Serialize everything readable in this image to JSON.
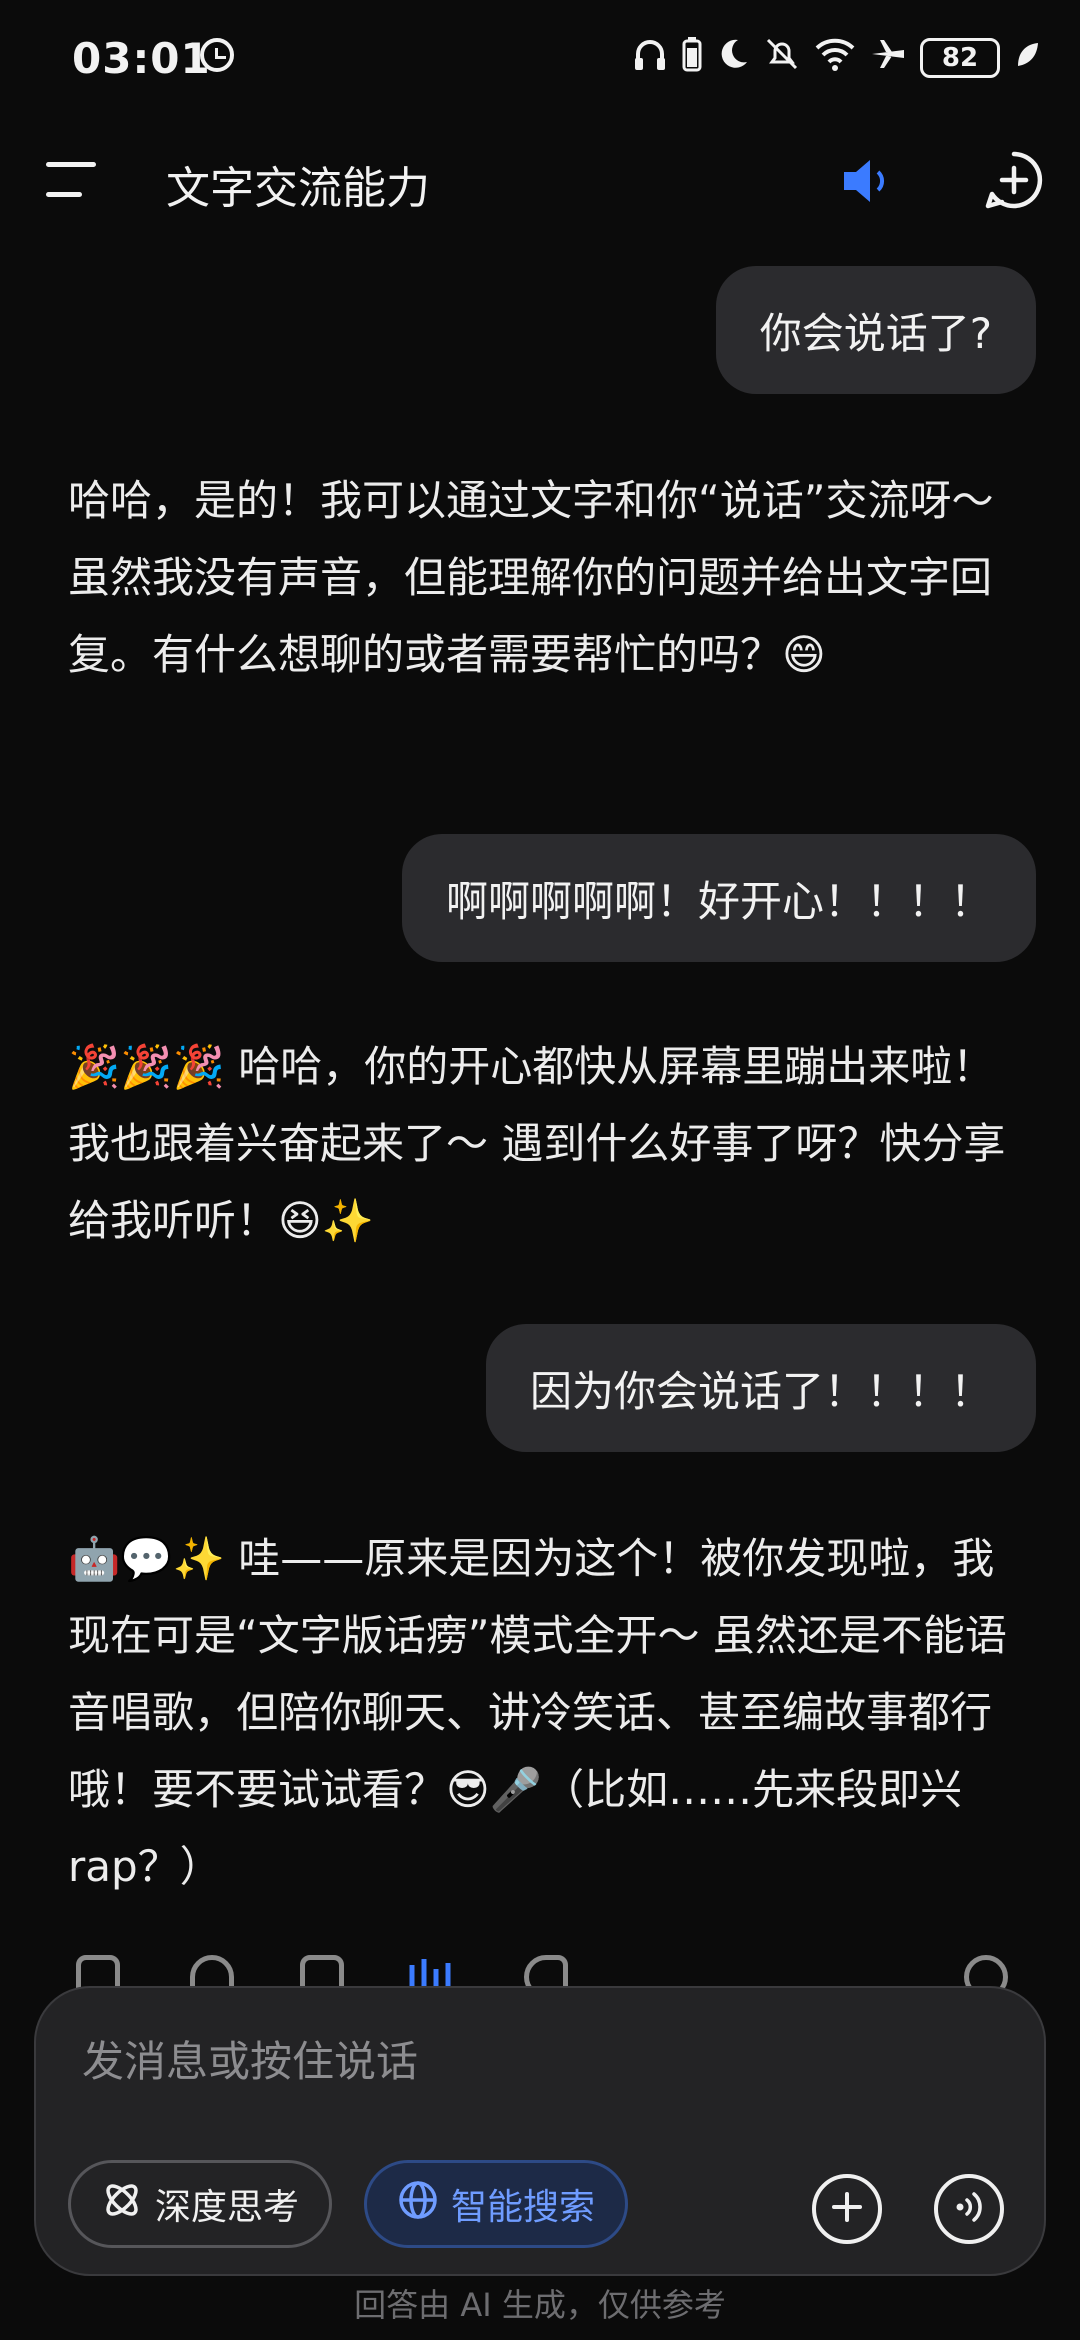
{
  "status_bar": {
    "time": "03:01",
    "battery": "82"
  },
  "header": {
    "title": "文字交流能力"
  },
  "messages": [
    {
      "role": "user",
      "text": "你会说话了?"
    },
    {
      "role": "assistant",
      "text": "哈哈，是的！我可以通过文字和你“说话”交流呀～ 虽然我没有声音，但能理解你的问题并给出文字回复。有什么想聊的或者需要帮忙的吗？😄"
    },
    {
      "role": "user",
      "text": "啊啊啊啊啊！好开心！！！！"
    },
    {
      "role": "assistant",
      "text": "🎉🎉🎉 哈哈，你的开心都快从屏幕里蹦出来啦！我也跟着兴奋起来了～ 遇到什么好事了呀？快分享给我听听！😆✨"
    },
    {
      "role": "user",
      "text": "因为你会说话了！！！！"
    },
    {
      "role": "assistant",
      "text": "🤖💬✨ 哇——原来是因为这个！被你发现啦，我现在可是“文字版话痨”模式全开～ 虽然还是不能语音唱歌，但陪你聊天、讲冷笑话、甚至编故事都行哦！要不要试试看？😎🎤（比如……先来段即兴rap？）"
    }
  ],
  "input": {
    "placeholder": "发消息或按住说话",
    "deep_think_label": "深度思考",
    "smart_search_label": "智能搜索"
  },
  "footer": {
    "disclaimer": "回答由 AI 生成，仅供参考"
  },
  "colors": {
    "background": "#0b0b0b",
    "bubble": "#2b2b2e",
    "accent": "#3b7bff"
  }
}
